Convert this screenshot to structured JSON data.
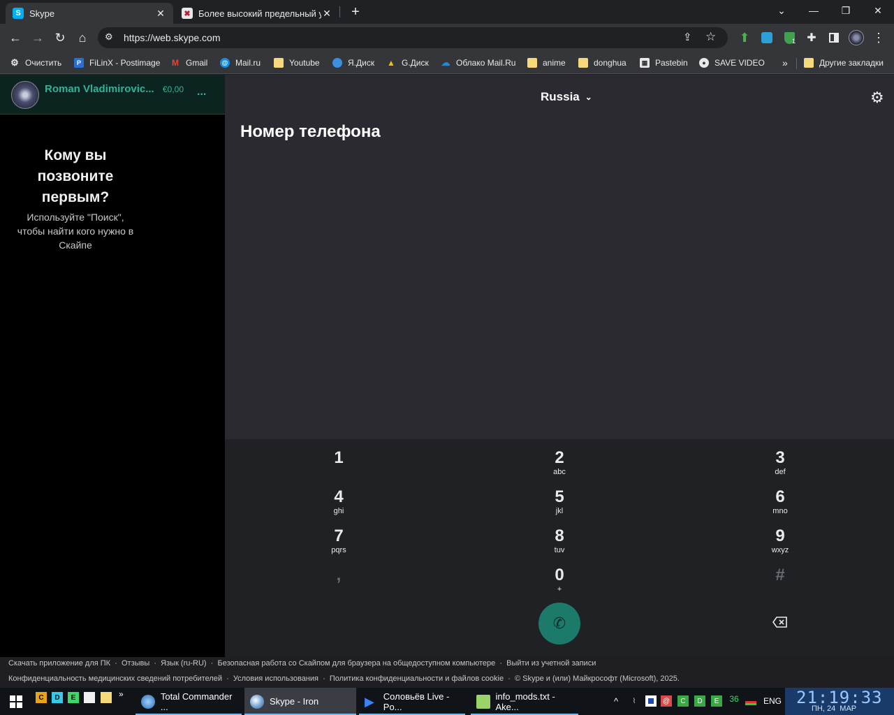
{
  "browser": {
    "tabs": [
      {
        "title": "Skype",
        "active": true
      },
      {
        "title": "Более высокий предельный ур",
        "active": false
      }
    ],
    "new_tab": "+",
    "url": "https://web.skype.com",
    "bookmarks": [
      {
        "label": "Очистить",
        "icon": "gear-icon"
      },
      {
        "label": "FiLinX - Postimage",
        "icon": "postimage-icon"
      },
      {
        "label": "Gmail",
        "icon": "gmail-icon"
      },
      {
        "label": "Mail.ru",
        "icon": "mailru-icon"
      },
      {
        "label": "Youtube",
        "icon": "folder-icon"
      },
      {
        "label": "Я.Диск",
        "icon": "yadisk-icon"
      },
      {
        "label": "G.Диск",
        "icon": "gdrive-icon"
      },
      {
        "label": "Облако Mail.Ru",
        "icon": "cloud-icon"
      },
      {
        "label": "anime",
        "icon": "folder-icon"
      },
      {
        "label": "donghua",
        "icon": "folder-icon"
      },
      {
        "label": "Pastebin",
        "icon": "pastebin-icon"
      },
      {
        "label": "SAVE VIDEO",
        "icon": "globe-icon"
      }
    ],
    "more_bookmarks": "»",
    "other_bookmarks": "Другие закладки",
    "extension_badge": "1"
  },
  "skype": {
    "profile": {
      "name": "Roman Vladimirovic...",
      "balance": "€0,00",
      "more": "..."
    },
    "empty_state": {
      "title": "Кому вы позвоните первым?",
      "text": "Используйте \"Поиск\", чтобы найти кого нужно в Скайпе"
    },
    "country": "Russia",
    "phone_label": "Номер телефона",
    "keys": [
      {
        "digit": "1",
        "letters": ""
      },
      {
        "digit": "2",
        "letters": "abc"
      },
      {
        "digit": "3",
        "letters": "def"
      },
      {
        "digit": "4",
        "letters": "ghi"
      },
      {
        "digit": "5",
        "letters": "jkl"
      },
      {
        "digit": "6",
        "letters": "mno"
      },
      {
        "digit": "7",
        "letters": "pqrs"
      },
      {
        "digit": "8",
        "letters": "tuv"
      },
      {
        "digit": "9",
        "letters": "wxyz"
      },
      {
        "digit": ",",
        "letters": ""
      },
      {
        "digit": "0",
        "letters": "+"
      },
      {
        "digit": "#",
        "letters": ""
      }
    ],
    "colors": {
      "accent": "#1b7a6a",
      "profile_name": "#2fb398"
    }
  },
  "footer": {
    "row1": [
      "Скачать приложение для ПК",
      "Отзывы",
      "Язык (ru-RU)",
      "Безопасная работа со Скайпом для браузера на общедоступном компьютере",
      "Выйти из учетной записи"
    ],
    "row2": [
      "Конфиденциальность медицинских сведений потребителей",
      "Условия использования",
      "Политика конфиденциальности и файлов cookie",
      "© Skype и (или) Майкрософт (Microsoft), 2025."
    ]
  },
  "taskbar": {
    "quick": [
      "C",
      "D",
      "E"
    ],
    "more": "»",
    "tasks": [
      {
        "title": "Total Commander ..."
      },
      {
        "title": "Skype - Iron"
      },
      {
        "title": "Соловьёв Live - Po..."
      },
      {
        "title": "info_mods.txt - Ake..."
      }
    ],
    "tray_number": "36",
    "lang": "ENG",
    "time": "21:19:33",
    "date": "ПН, 24  МАР"
  }
}
